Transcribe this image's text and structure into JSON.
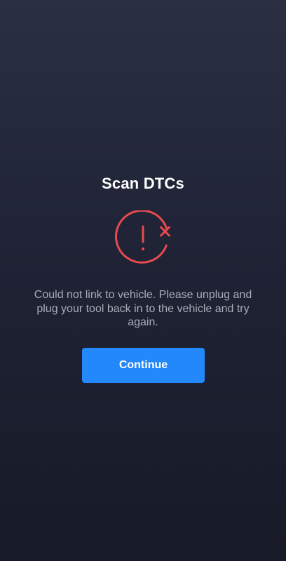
{
  "screen": {
    "title": "Scan DTCs",
    "status_icon": "disconnected-alert-icon",
    "message": "Could not link to vehicle. Please unplug and plug your tool back in to the vehicle and try again.",
    "continue_label": "Continue"
  },
  "colors": {
    "alert_red": "#e84a4f",
    "primary_button": "#2288fc",
    "message_text": "#a9adb8",
    "background_top": "#2a2f42",
    "background_bottom": "#171a27"
  }
}
